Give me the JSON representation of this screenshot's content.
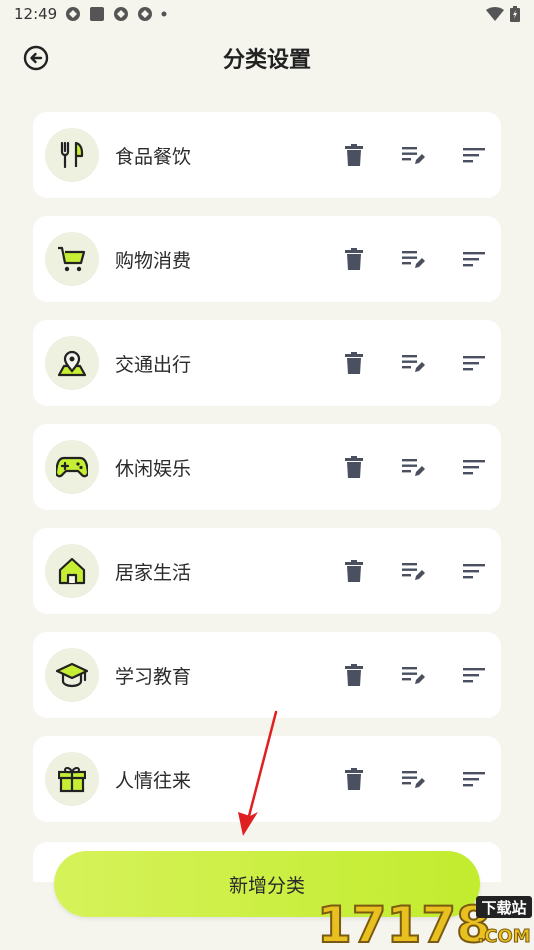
{
  "status_bar": {
    "time": "12:49"
  },
  "header": {
    "title": "分类设置"
  },
  "categories": [
    {
      "label": "食品餐饮",
      "icon": "utensils-icon"
    },
    {
      "label": "购物消费",
      "icon": "cart-icon"
    },
    {
      "label": "交通出行",
      "icon": "location-icon"
    },
    {
      "label": "休闲娱乐",
      "icon": "gamepad-icon"
    },
    {
      "label": "居家生活",
      "icon": "home-icon"
    },
    {
      "label": "学习教育",
      "icon": "graduation-cap-icon"
    },
    {
      "label": "人情往来",
      "icon": "gift-icon"
    }
  ],
  "add_button": {
    "label": "新增分类"
  },
  "watermark": {
    "text": "17178",
    "tag": "下载站",
    "domain": ".COM"
  },
  "colors": {
    "background": "#f5f5ee",
    "accent": "#c6ee35",
    "icon_dark": "#4a5060",
    "icon_circle": "#eef0e0",
    "arrow": "#e02020"
  }
}
